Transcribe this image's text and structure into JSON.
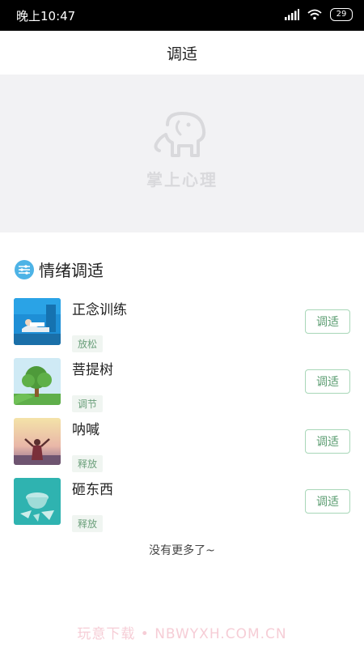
{
  "status_bar": {
    "time": "晚上10:47",
    "battery": "29"
  },
  "header": {
    "title": "调适"
  },
  "banner": {
    "logo_text": "掌上心理",
    "logo_icon": "elephant-icon"
  },
  "section": {
    "title": "情绪调适",
    "icon": "sliders-icon"
  },
  "items": [
    {
      "title": "正念训练",
      "tag": "放松",
      "button": "调适"
    },
    {
      "title": "菩提树",
      "tag": "调节",
      "button": "调适"
    },
    {
      "title": "呐喊",
      "tag": "释放",
      "button": "调适"
    },
    {
      "title": "砸东西",
      "tag": "释放",
      "button": "调适"
    }
  ],
  "footer": {
    "end_text": "没有更多了~",
    "watermark": "玩意下载 • NBWYXH.COM.CN"
  }
}
